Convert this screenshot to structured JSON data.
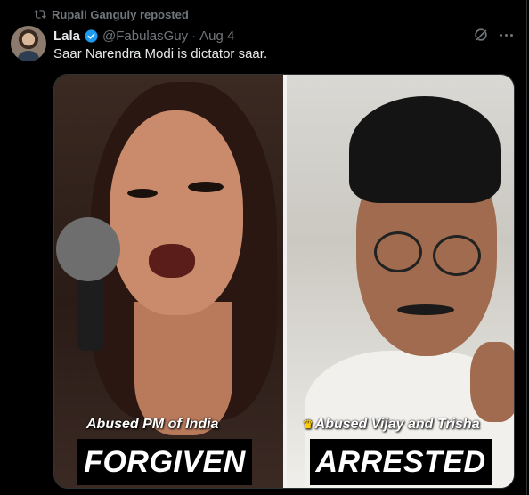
{
  "repost": {
    "text": "Rupali Ganguly reposted",
    "icon": "repost-icon"
  },
  "author": {
    "name": "Lala",
    "handle": "@FabulasGuy",
    "separator": "·",
    "date": "Aug 4",
    "verified_color": "#1d9bf0"
  },
  "tweet": {
    "text": "Saar Narendra Modi is dictator saar."
  },
  "media": {
    "left": {
      "caption": "Abused PM of India",
      "stamp": "FORGIVEN"
    },
    "right": {
      "caption_prefix": "♛",
      "caption": "Abused Vijay and Trisha",
      "stamp": "ARRESTED"
    }
  },
  "colors": {
    "background": "#000000",
    "text": "#e7e9ea",
    "muted": "#71767b",
    "accent": "#1d9bf0"
  }
}
